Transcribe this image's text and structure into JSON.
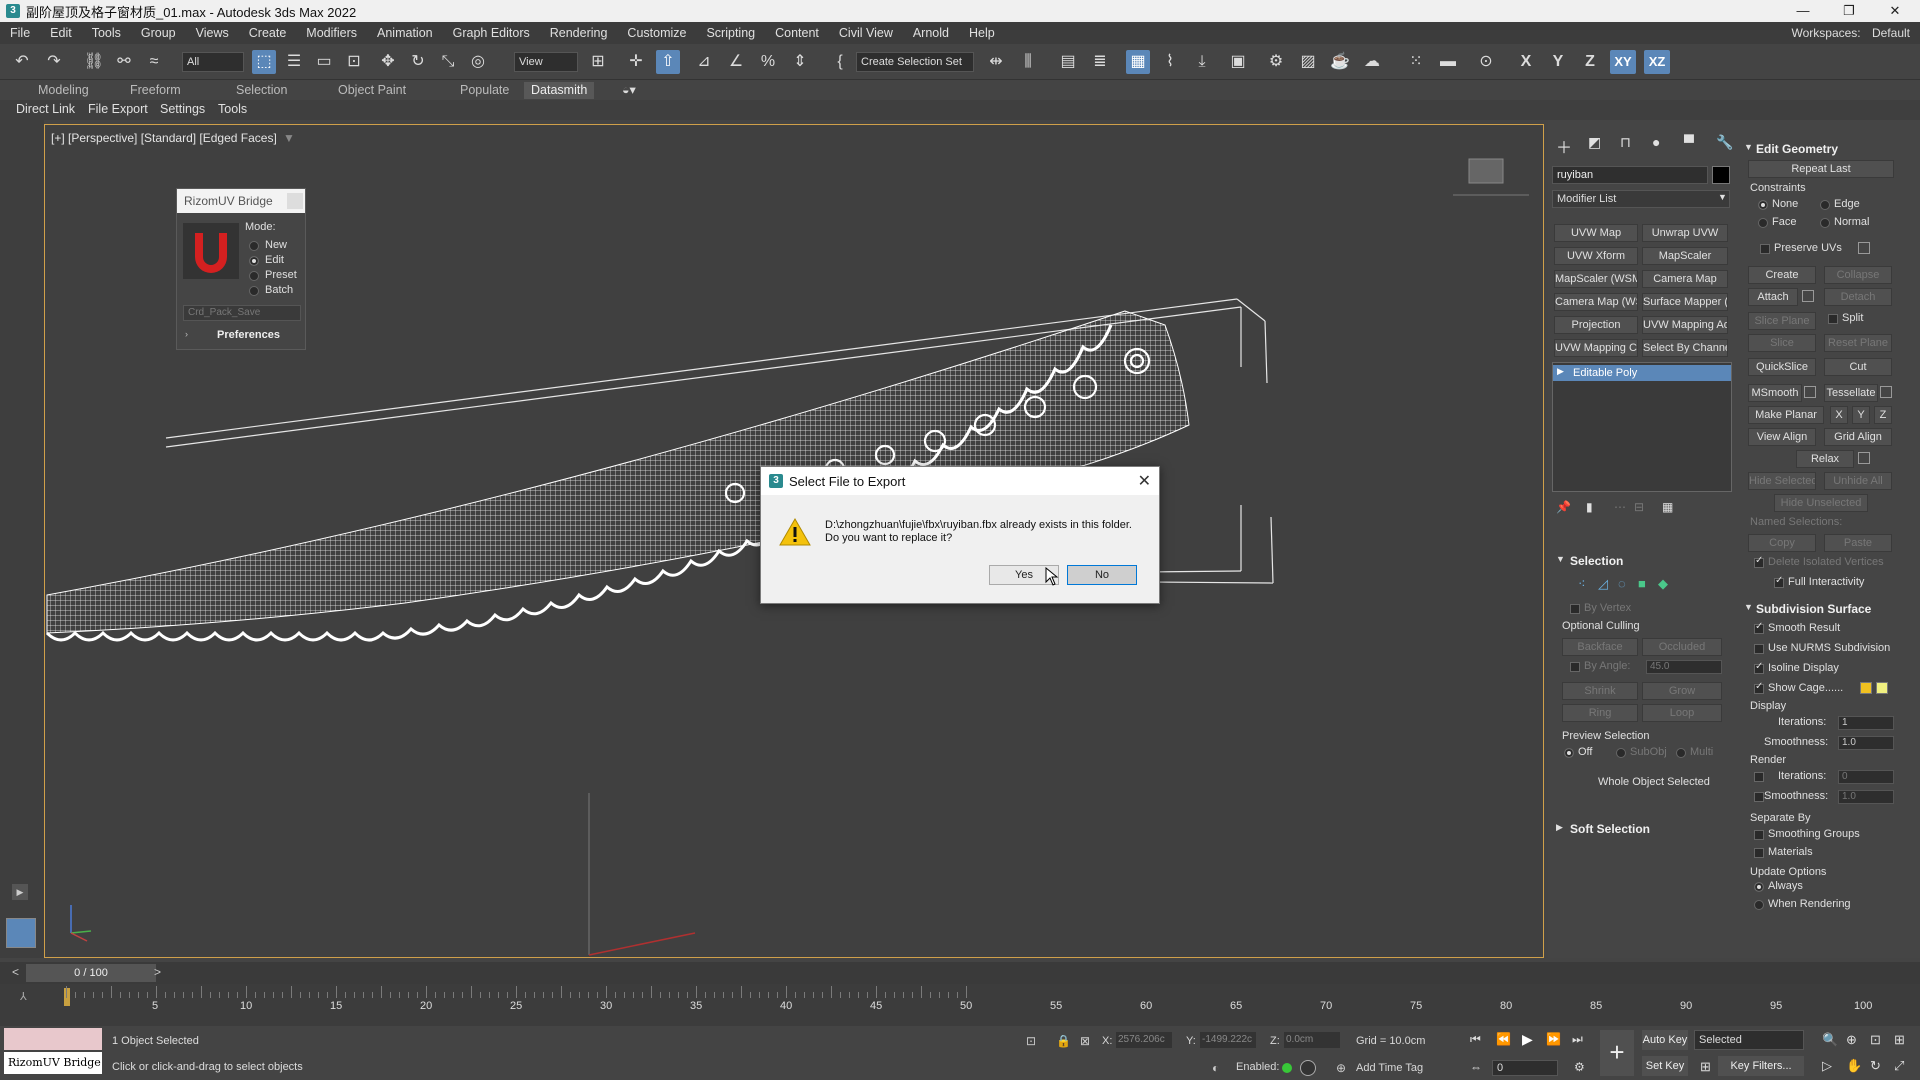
{
  "window": {
    "title": "副阶屋顶及格子窗材质_01.max - Autodesk 3ds Max 2022",
    "app_icon": "3"
  },
  "menu": [
    "File",
    "Edit",
    "Tools",
    "Group",
    "Views",
    "Create",
    "Modifiers",
    "Animation",
    "Graph Editors",
    "Rendering",
    "Customize",
    "Scripting",
    "Content",
    "Civil View",
    "Arnold",
    "Help"
  ],
  "workspaces": {
    "label": "Workspaces:",
    "value": "Default"
  },
  "toolbar": {
    "filter": "All",
    "ref_coord": "View",
    "named_sel": "Create Selection Set",
    "x": "X",
    "y": "Y",
    "z": "Z",
    "xy": "XY",
    "xz": "XZ"
  },
  "ribbon_tabs": [
    "Modeling",
    "Freeform",
    "Selection",
    "Object Paint",
    "Populate",
    "Datasmith"
  ],
  "sub_tabs": [
    "Direct Link",
    "File Export",
    "Settings",
    "Tools"
  ],
  "viewport": {
    "label": "[+] [Perspective] [Standard] [Edged Faces]"
  },
  "rizom": {
    "title": "RizomUV Bridge",
    "mode_label": "Mode:",
    "modes": [
      "New",
      "Edit",
      "Preset",
      "Batch"
    ],
    "preset_value": "Crd_Pack_Save",
    "prefs": "Preferences"
  },
  "dialog": {
    "title": "Select File to Export",
    "line1": "D:\\zhongzhuan\\fujie\\fbx\\ruyiban.fbx already exists in this folder.",
    "line2": "Do you want to replace it?",
    "yes": "Yes",
    "no": "No"
  },
  "command_panel": {
    "object_name": "ruyiban",
    "modifier_list": "Modifier List",
    "mod_buttons": [
      "UVW Map",
      "Unwrap UVW",
      "UVW Xform",
      "MapScaler",
      "MapScaler (WSM)",
      "Camera Map",
      "Camera Map (WSM)",
      "Surface Mapper (WSM)",
      "Projection",
      "UVW Mapping Add",
      "UVW Mapping Clear",
      "Select By Channel"
    ],
    "stack_item": "Editable Poly",
    "selection": {
      "title": "Selection",
      "by_vertex": "By Vertex",
      "optional_culling": "Optional Culling",
      "backface": "Backface",
      "occluded": "Occluded",
      "by_angle": "By Angle:",
      "angle_val": "45.0",
      "shrink": "Shrink",
      "grow": "Grow",
      "ring": "Ring",
      "loop": "Loop",
      "preview": "Preview Selection",
      "off": "Off",
      "subobj": "SubObj",
      "multi": "Multi",
      "status": "Whole Object Selected"
    },
    "soft_selection": "Soft Selection",
    "edit_geometry": {
      "title": "Edit Geometry",
      "repeat_last": "Repeat Last",
      "constraints": "Constraints",
      "none": "None",
      "edge": "Edge",
      "face": "Face",
      "normal": "Normal",
      "preserve_uvs": "Preserve UVs",
      "create": "Create",
      "collapse": "Collapse",
      "attach": "Attach",
      "detach": "Detach",
      "slice_plane": "Slice Plane",
      "split": "Split",
      "slice": "Slice",
      "reset_plane": "Reset Plane",
      "quickslice": "QuickSlice",
      "cut": "Cut",
      "msmooth": "MSmooth",
      "tessellate": "Tessellate",
      "make_planar": "Make Planar",
      "x": "X",
      "y": "Y",
      "z": "Z",
      "view_align": "View Align",
      "grid_align": "Grid Align",
      "relax": "Relax",
      "hide_selected": "Hide Selected",
      "unhide_all": "Unhide All",
      "hide_unselected": "Hide Unselected",
      "named_selections": "Named Selections:",
      "copy": "Copy",
      "paste": "Paste",
      "delete_isolated": "Delete Isolated Vertices",
      "full_interactivity": "Full Interactivity"
    },
    "subdivision": {
      "title": "Subdivision Surface",
      "smooth_result": "Smooth Result",
      "nurms": "Use NURMS Subdivision",
      "isoline": "Isoline Display",
      "show_cage": "Show Cage......",
      "display": "Display",
      "iterations": "Iterations:",
      "iter_val": "1",
      "smoothness": "Smoothness:",
      "smooth_val": "1.0",
      "render": "Render",
      "r_iter_val": "0",
      "r_smooth_val": "1.0",
      "separate_by": "Separate By",
      "smoothing_groups": "Smoothing Groups",
      "materials": "Materials",
      "update_options": "Update Options",
      "always": "Always",
      "when_rendering": "When Rendering"
    }
  },
  "timeline": {
    "frame": "0 / 100",
    "ticks": [
      "5",
      "10",
      "15",
      "20",
      "25",
      "30",
      "35",
      "40",
      "45",
      "50",
      "55",
      "60",
      "65",
      "70",
      "75",
      "80",
      "85",
      "90",
      "95",
      "100"
    ]
  },
  "status": {
    "objects": "1 Object Selected",
    "prompt": "Click or click-and-drag to select objects",
    "script_label": "RizomUV Bridge",
    "x_label": "X:",
    "x_val": "2576.206c",
    "y_label": "Y:",
    "y_val": "-1499.222c",
    "z_label": "Z:",
    "z_val": "0.0cm",
    "grid": "Grid = 10.0cm",
    "enabled": "Enabled:",
    "add_time_tag": "Add Time Tag",
    "auto_key": "Auto Key",
    "selected": "Selected",
    "set_key": "Set Key",
    "key_filters": "Key Filters...",
    "frame_val": "0"
  }
}
